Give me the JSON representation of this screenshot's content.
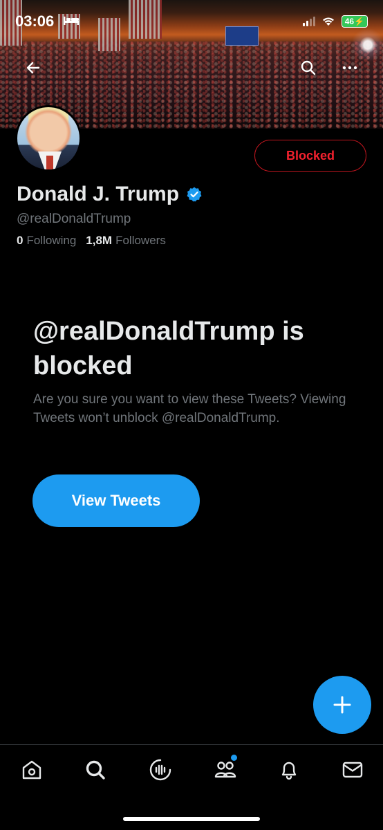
{
  "status_bar": {
    "time": "03:06",
    "battery": "46"
  },
  "banner": {
    "icons": [
      "back-arrow-icon",
      "search-icon",
      "more-icon"
    ]
  },
  "profile": {
    "display_name": "Donald J. Trump",
    "verified": true,
    "handle": "@realDonaldTrump",
    "following_count": "0",
    "following_label": "Following",
    "followers_count": "1,8M",
    "followers_label": "Followers",
    "blocked_button": "Blocked"
  },
  "blocked_notice": {
    "title": "@realDonaldTrump is blocked",
    "description": "Are you sure you want to view these Tweets? Viewing Tweets won’t unblock @realDonaldTrump.",
    "view_button": "View Tweets"
  },
  "bottom_nav": {
    "items": [
      "home-icon",
      "search-icon",
      "spaces-icon",
      "communities-icon",
      "notifications-icon",
      "messages-icon"
    ]
  },
  "colors": {
    "accent": "#1d9bf0",
    "danger": "#f4212e",
    "text_primary": "#e7e9ea",
    "text_secondary": "#71767b"
  }
}
